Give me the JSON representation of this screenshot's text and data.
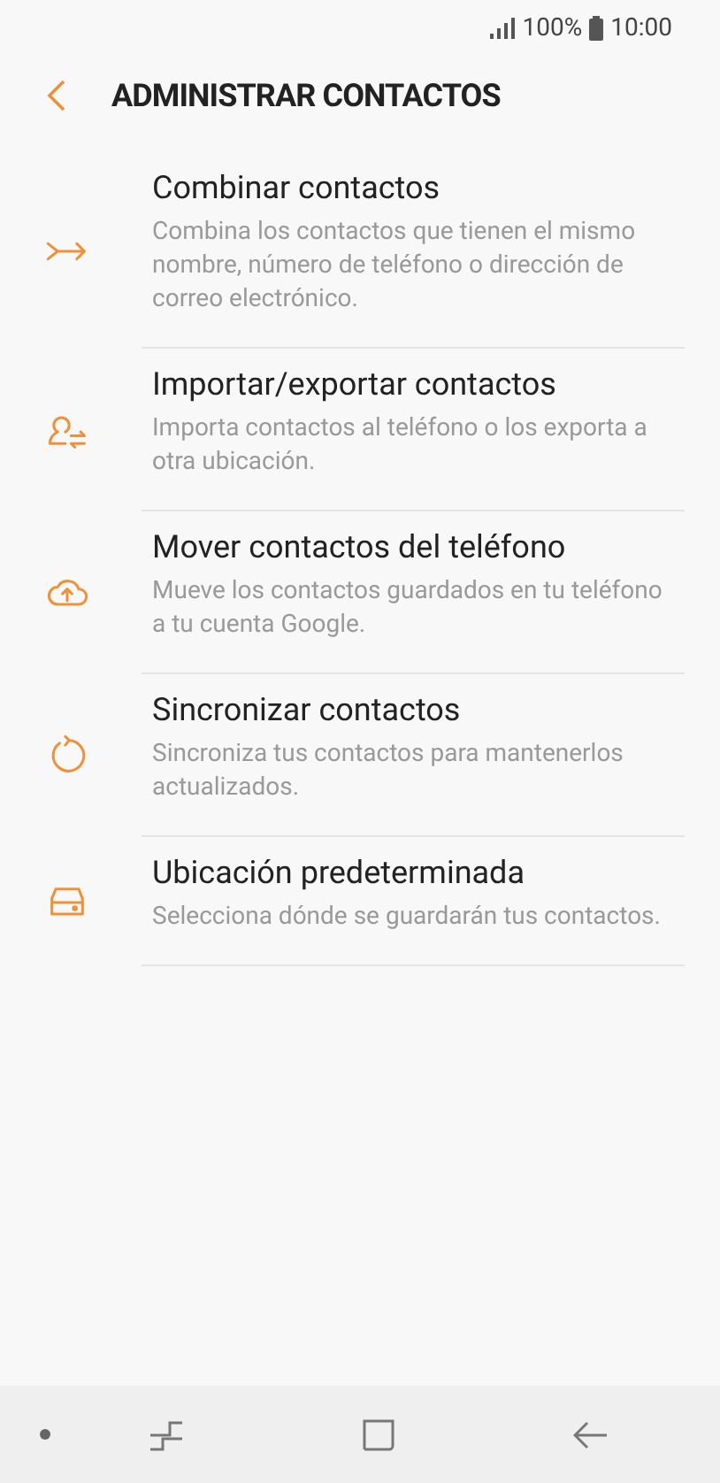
{
  "status_bar": {
    "battery": "100%",
    "time": "10:00"
  },
  "header": {
    "title": "ADMINISTRAR CONTACTOS"
  },
  "items": [
    {
      "kind": "merge",
      "title": "Combinar contactos",
      "description": "Combina los contactos que tienen el mismo nombre, número de teléfono o dirección de correo electrónico."
    },
    {
      "kind": "import",
      "title": "Importar/exportar contactos",
      "description": "Importa contactos al teléfono o los exporta a otra ubicación."
    },
    {
      "kind": "move",
      "title": "Mover contactos del teléfono",
      "description": "Mueve los contactos guardados en tu teléfono a tu cuenta Google."
    },
    {
      "kind": "sync",
      "title": "Sincronizar contactos",
      "description": "Sincroniza tus contactos para mantenerlos actualizados."
    },
    {
      "kind": "storage",
      "title": "Ubicación predeterminada",
      "description": "Selecciona dónde se guardarán tus contactos."
    }
  ]
}
